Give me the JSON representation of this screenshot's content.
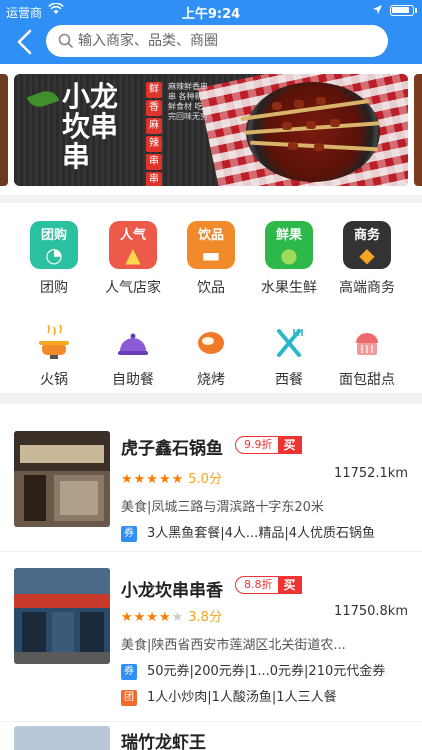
{
  "status_bar": {
    "carrier": "运营商",
    "time": "上午9:24"
  },
  "search": {
    "placeholder": "输入商家、品类、商圈"
  },
  "banner": {
    "title": "小龙坎串串",
    "tags": [
      "鲜",
      "香",
      "麻",
      "辣",
      "串",
      "串"
    ],
    "desc": "麻辣鲜香串串 各种新鲜食材 吃完回味无穷"
  },
  "categories_row1": [
    {
      "icon_text": "团购",
      "label": "团购",
      "icon": "group-buy-icon",
      "color": "#2bc0a0"
    },
    {
      "icon_text": "人气",
      "label": "人气店家",
      "icon": "popular-icon",
      "color": "#ee5a4a"
    },
    {
      "icon_text": "饮品",
      "label": "饮品",
      "icon": "drinks-icon",
      "color": "#f08a2a"
    },
    {
      "icon_text": "鲜果",
      "label": "水果生鲜",
      "icon": "fruit-icon",
      "color": "#2fb84a"
    },
    {
      "icon_text": "商务",
      "label": "高端商务",
      "icon": "business-icon",
      "color": "#333333"
    }
  ],
  "categories_row2": [
    {
      "label": "火锅",
      "icon": "hotpot-icon"
    },
    {
      "label": "自助餐",
      "icon": "buffet-icon"
    },
    {
      "label": "烧烤",
      "icon": "bbq-icon"
    },
    {
      "label": "西餐",
      "icon": "western-food-icon"
    },
    {
      "label": "面包甜点",
      "icon": "dessert-icon"
    }
  ],
  "merchants": [
    {
      "name": "虎子鑫石锅鱼",
      "discount": "9.9折",
      "buy": "买",
      "rating": 5,
      "score": "5.0分",
      "distance": "11752.1km",
      "address": "美食|凤城三路与渭滨路十字东20米",
      "deals": [
        {
          "tag": "券",
          "text": "3人黑鱼套餐|4人...精品|4人优质石锅鱼"
        }
      ]
    },
    {
      "name": "小龙坎串串香",
      "discount": "8.8折",
      "buy": "买",
      "rating": 3.8,
      "score": "3.8分",
      "distance": "11750.8km",
      "address": "美食|陕西省西安市莲湖区北关街道农...",
      "deals": [
        {
          "tag": "券",
          "text": "50元券|200元券|1...0元券|210元代金券"
        },
        {
          "tag": "团",
          "text": "1人小炒肉|1人酸汤鱼|1人三人餐"
        }
      ]
    },
    {
      "name": "瑞竹龙虾王"
    }
  ]
}
